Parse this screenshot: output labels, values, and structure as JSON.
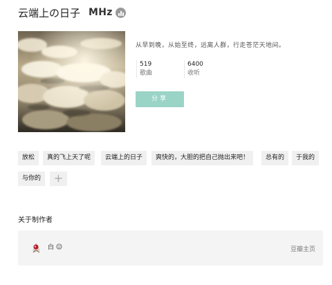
{
  "header": {
    "title": "云端上の日子",
    "host": "MHz",
    "badge_icon": "bar-chart-icon"
  },
  "info": {
    "description": "从早到晚，从始至终，远离人群，行走苍茫天地间。",
    "stats": [
      {
        "value": "519",
        "label": "歌曲"
      },
      {
        "value": "6400",
        "label": "收听"
      }
    ],
    "share_label": "分享",
    "share_color": "#9ad4c6"
  },
  "tags": [
    "放松",
    "真的飞上天了呢",
    "云端上的日子",
    "爽快的，大胆的把自己抛出来吧！",
    "总有的",
    "于我的",
    "与你的"
  ],
  "add_tag_icon": "plus-icon",
  "maker": {
    "section_title": "关于制作者",
    "name": "白",
    "name_icon": "face-icon",
    "link": "豆瓣主页"
  }
}
